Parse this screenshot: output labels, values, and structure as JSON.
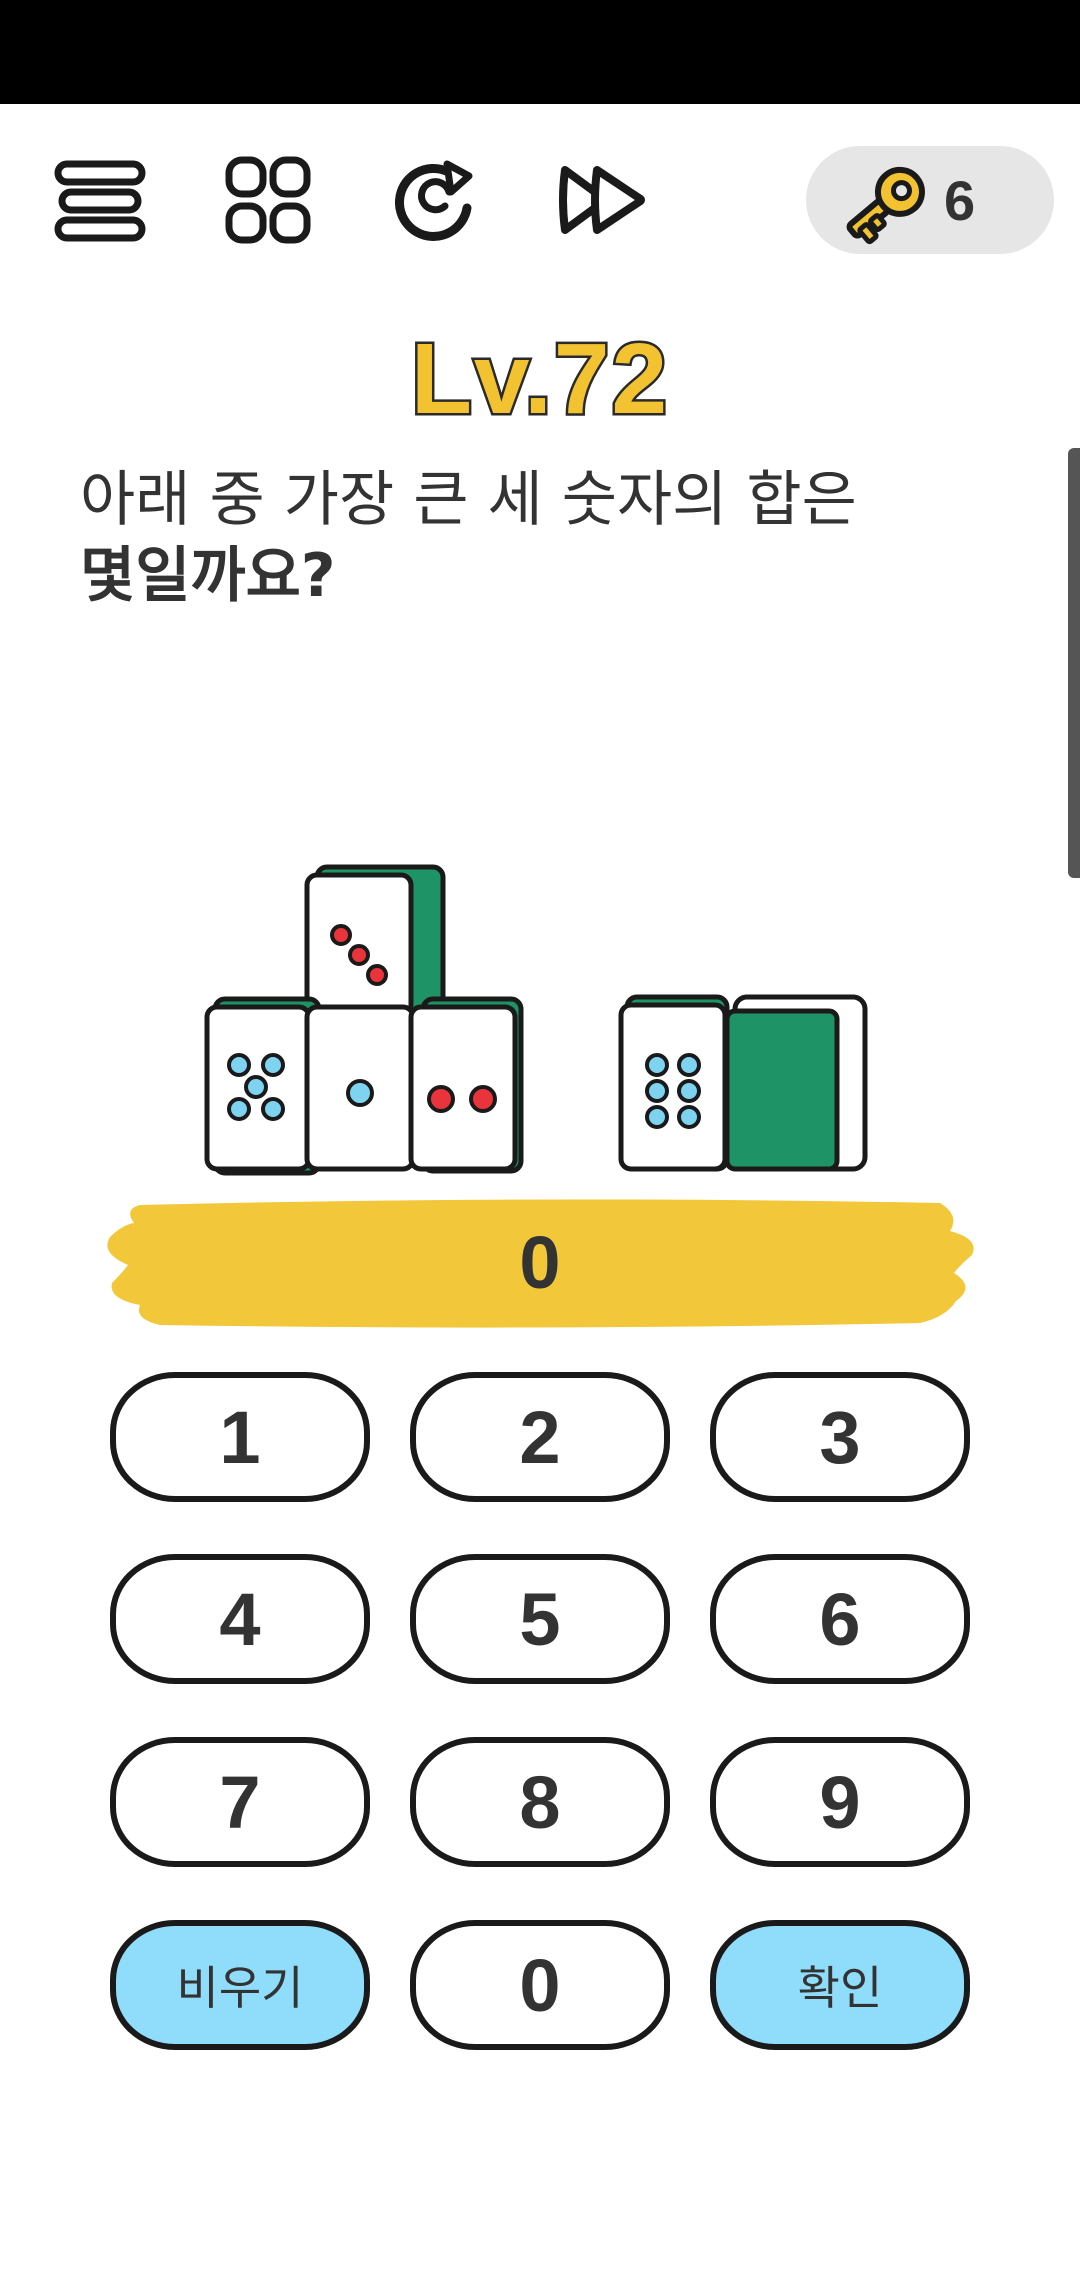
{
  "toolbar": {
    "menu_icon": "menu-icon",
    "levels_icon": "grid-icon",
    "restart_icon": "restart-icon",
    "skip_icon": "fast-forward-icon"
  },
  "hints": {
    "icon": "key-icon",
    "count": "6"
  },
  "level": {
    "title": "Lv.72"
  },
  "question": {
    "line1": "아래 중 가장 큰 세 숫자의 합은",
    "line2": "몇일까요?"
  },
  "answer": {
    "value": "0"
  },
  "keypad": {
    "keys": [
      "1",
      "2",
      "3",
      "4",
      "5",
      "6",
      "7",
      "8",
      "9"
    ],
    "clear_label": "비우기",
    "zero_label": "0",
    "confirm_label": "확인"
  },
  "colors": {
    "accent_yellow": "#f2c230",
    "key_blue": "#8fdcfb",
    "tile_green": "#1e9466",
    "dot_red": "#e8343a",
    "dot_blue": "#7dd3f0"
  }
}
